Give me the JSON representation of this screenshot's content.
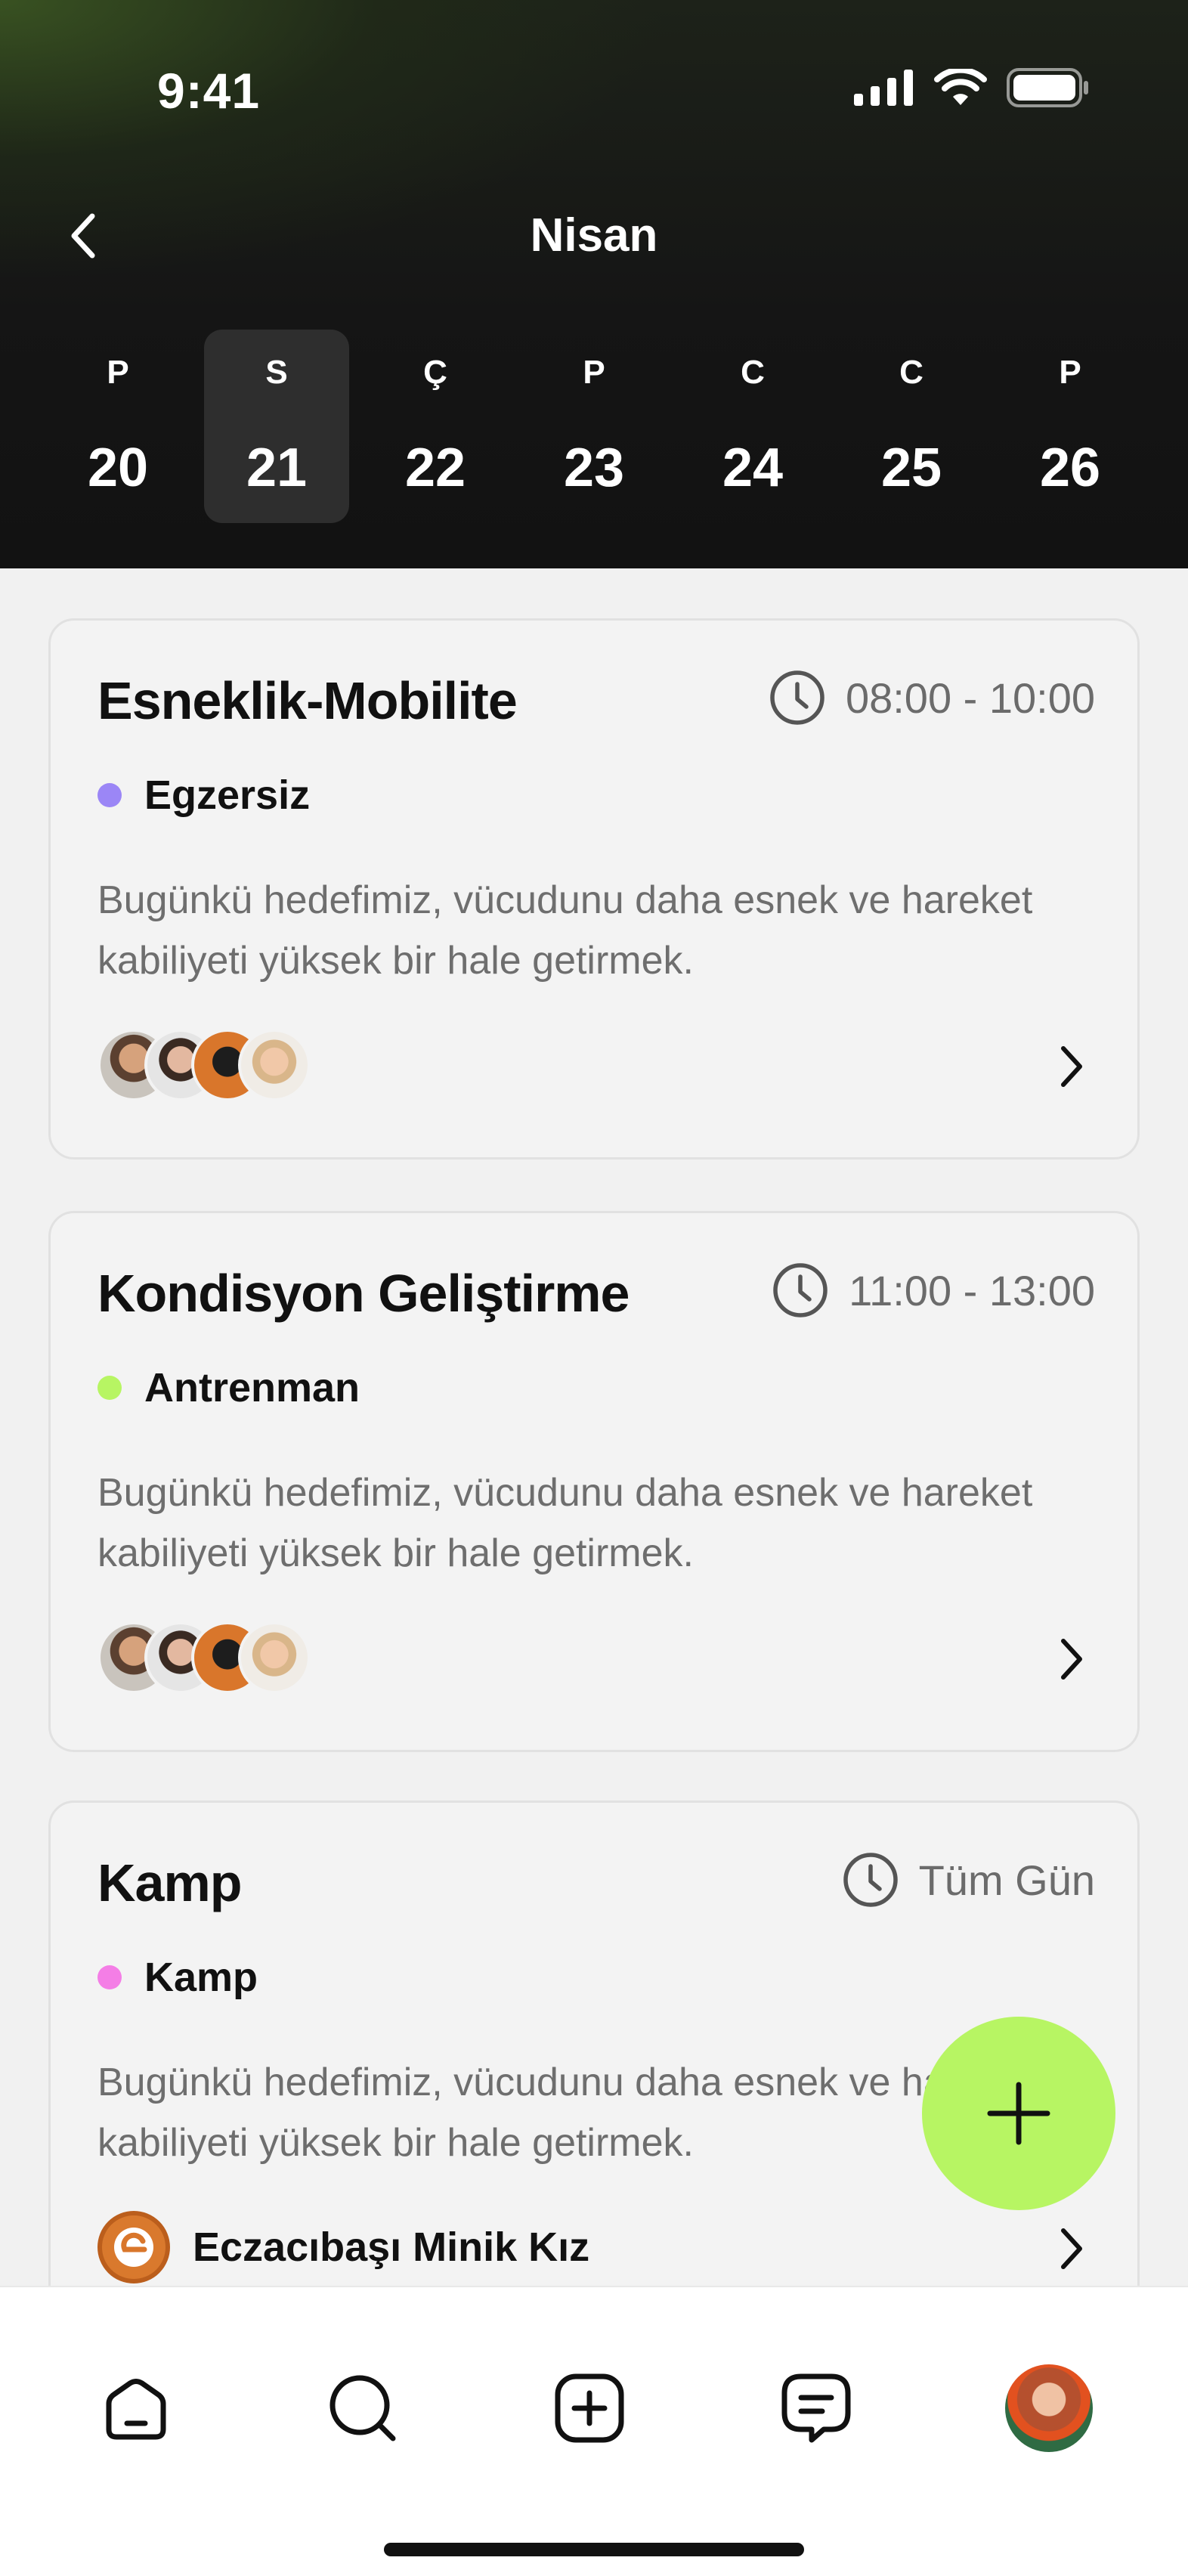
{
  "status": {
    "time": "9:41"
  },
  "header": {
    "title": "Nisan"
  },
  "week": [
    {
      "letter": "P",
      "num": "20"
    },
    {
      "letter": "S",
      "num": "21",
      "selected": true
    },
    {
      "letter": "Ç",
      "num": "22"
    },
    {
      "letter": "P",
      "num": "23"
    },
    {
      "letter": "C",
      "num": "24"
    },
    {
      "letter": "C",
      "num": "25"
    },
    {
      "letter": "P",
      "num": "26"
    }
  ],
  "events": [
    {
      "title": "Esneklik-Mobilite",
      "time": "08:00 - 10:00",
      "tag": "Egzersiz",
      "tag_color": "#9b86f6",
      "description": "Bugünkü hedefimiz, vücudunu daha esnek ve hareket kabiliyeti yüksek bir hale getirmek."
    },
    {
      "title": "Kondisyon Geliştirme",
      "time": "11:00 - 13:00",
      "tag": "Antrenman",
      "tag_color": "#b7f563",
      "description": "Bugünkü hedefimiz, vücudunu daha esnek ve hareket kabiliyeti yüksek bir hale getirmek."
    },
    {
      "title": "Kamp",
      "time": "Tüm Gün",
      "tag": "Kamp",
      "tag_color": "#f47ee6",
      "description": "Bugünkü hedefimiz, vücudunu daha esnek ve hareket kabiliyeti yüksek bir hale getirmek.",
      "club": "Eczacıbaşı Minik Kız"
    }
  ],
  "colors": {
    "accent": "#b7f563",
    "header_bg": "#131313"
  },
  "icons": {
    "back": "chevron-left-icon",
    "clock": "clock-icon",
    "chevron": "chevron-right-icon",
    "fab": "plus-icon",
    "nav": [
      "home-icon",
      "search-icon",
      "add-square-icon",
      "messages-icon",
      "profile-avatar"
    ]
  }
}
